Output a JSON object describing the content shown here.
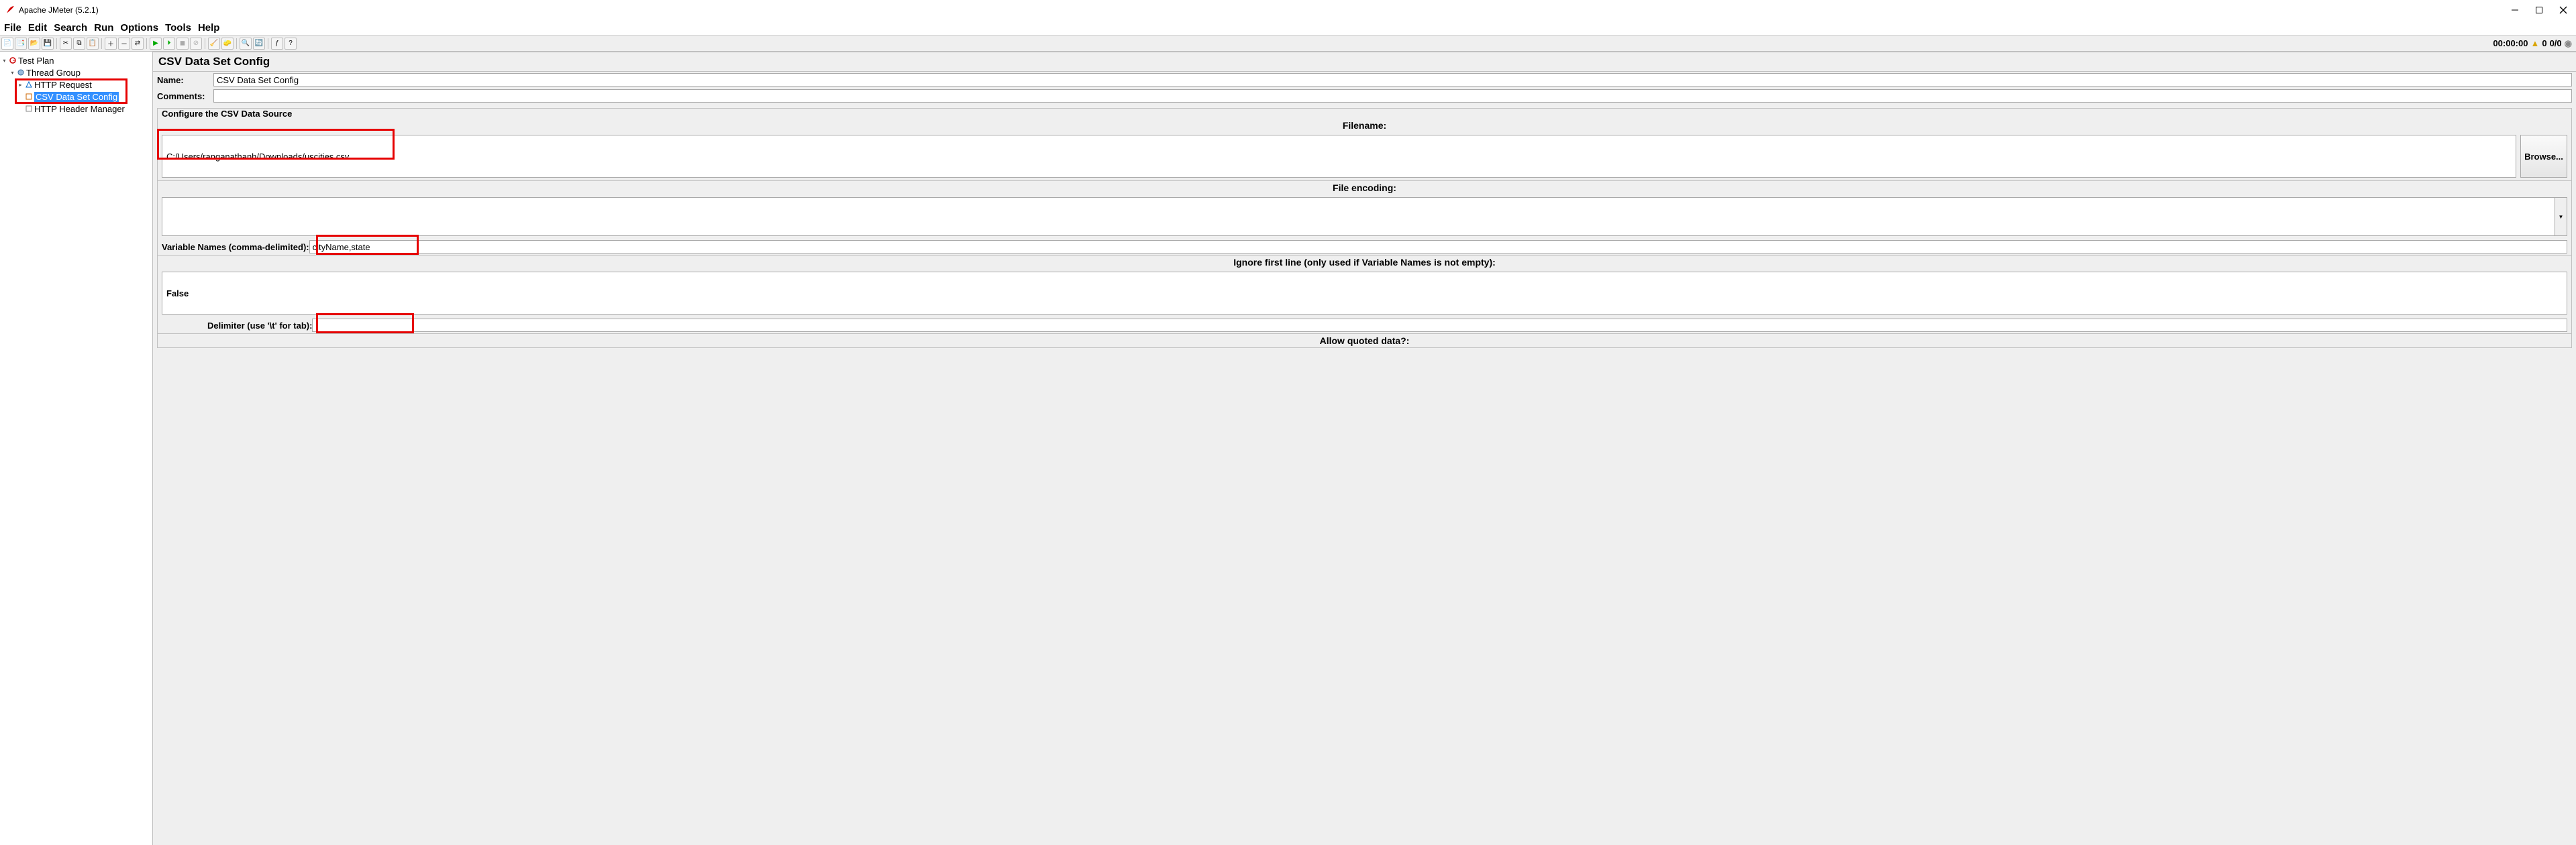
{
  "window": {
    "title": "Apache JMeter (5.2.1)"
  },
  "menu": [
    "File",
    "Edit",
    "Search",
    "Run",
    "Options",
    "Tools",
    "Help"
  ],
  "status": {
    "time": "00:00:00",
    "warn": "0",
    "counts": "0/0"
  },
  "tree": {
    "root": "Test Plan",
    "threadGroup": "Thread Group",
    "httpRequest": "HTTP Request",
    "csv": "CSV Data Set Config",
    "headerMgr": "HTTP Header Manager"
  },
  "panel": {
    "title": "CSV Data Set Config",
    "nameLabel": "Name:",
    "nameValue": "CSV Data Set Config",
    "commentsLabel": "Comments:",
    "commentsValue": "",
    "groupTitle": "Configure the CSV Data Source",
    "filenameLabel": "Filename:",
    "filenameValue": "C:/Users/ranganathanh/Downloads/uscities.csv",
    "browse": "Browse...",
    "encodingLabel": "File encoding:",
    "varNamesLabel": "Variable Names (comma-delimited):",
    "varNamesValue": "cityName,state",
    "ignoreLabel": "Ignore first line (only used if Variable Names is not empty):",
    "ignoreValue": "False",
    "delimiterLabel": "Delimiter (use '\\t' for tab):",
    "delimiterValue": ",",
    "allowQuotedLabel": "Allow quoted data?:"
  }
}
